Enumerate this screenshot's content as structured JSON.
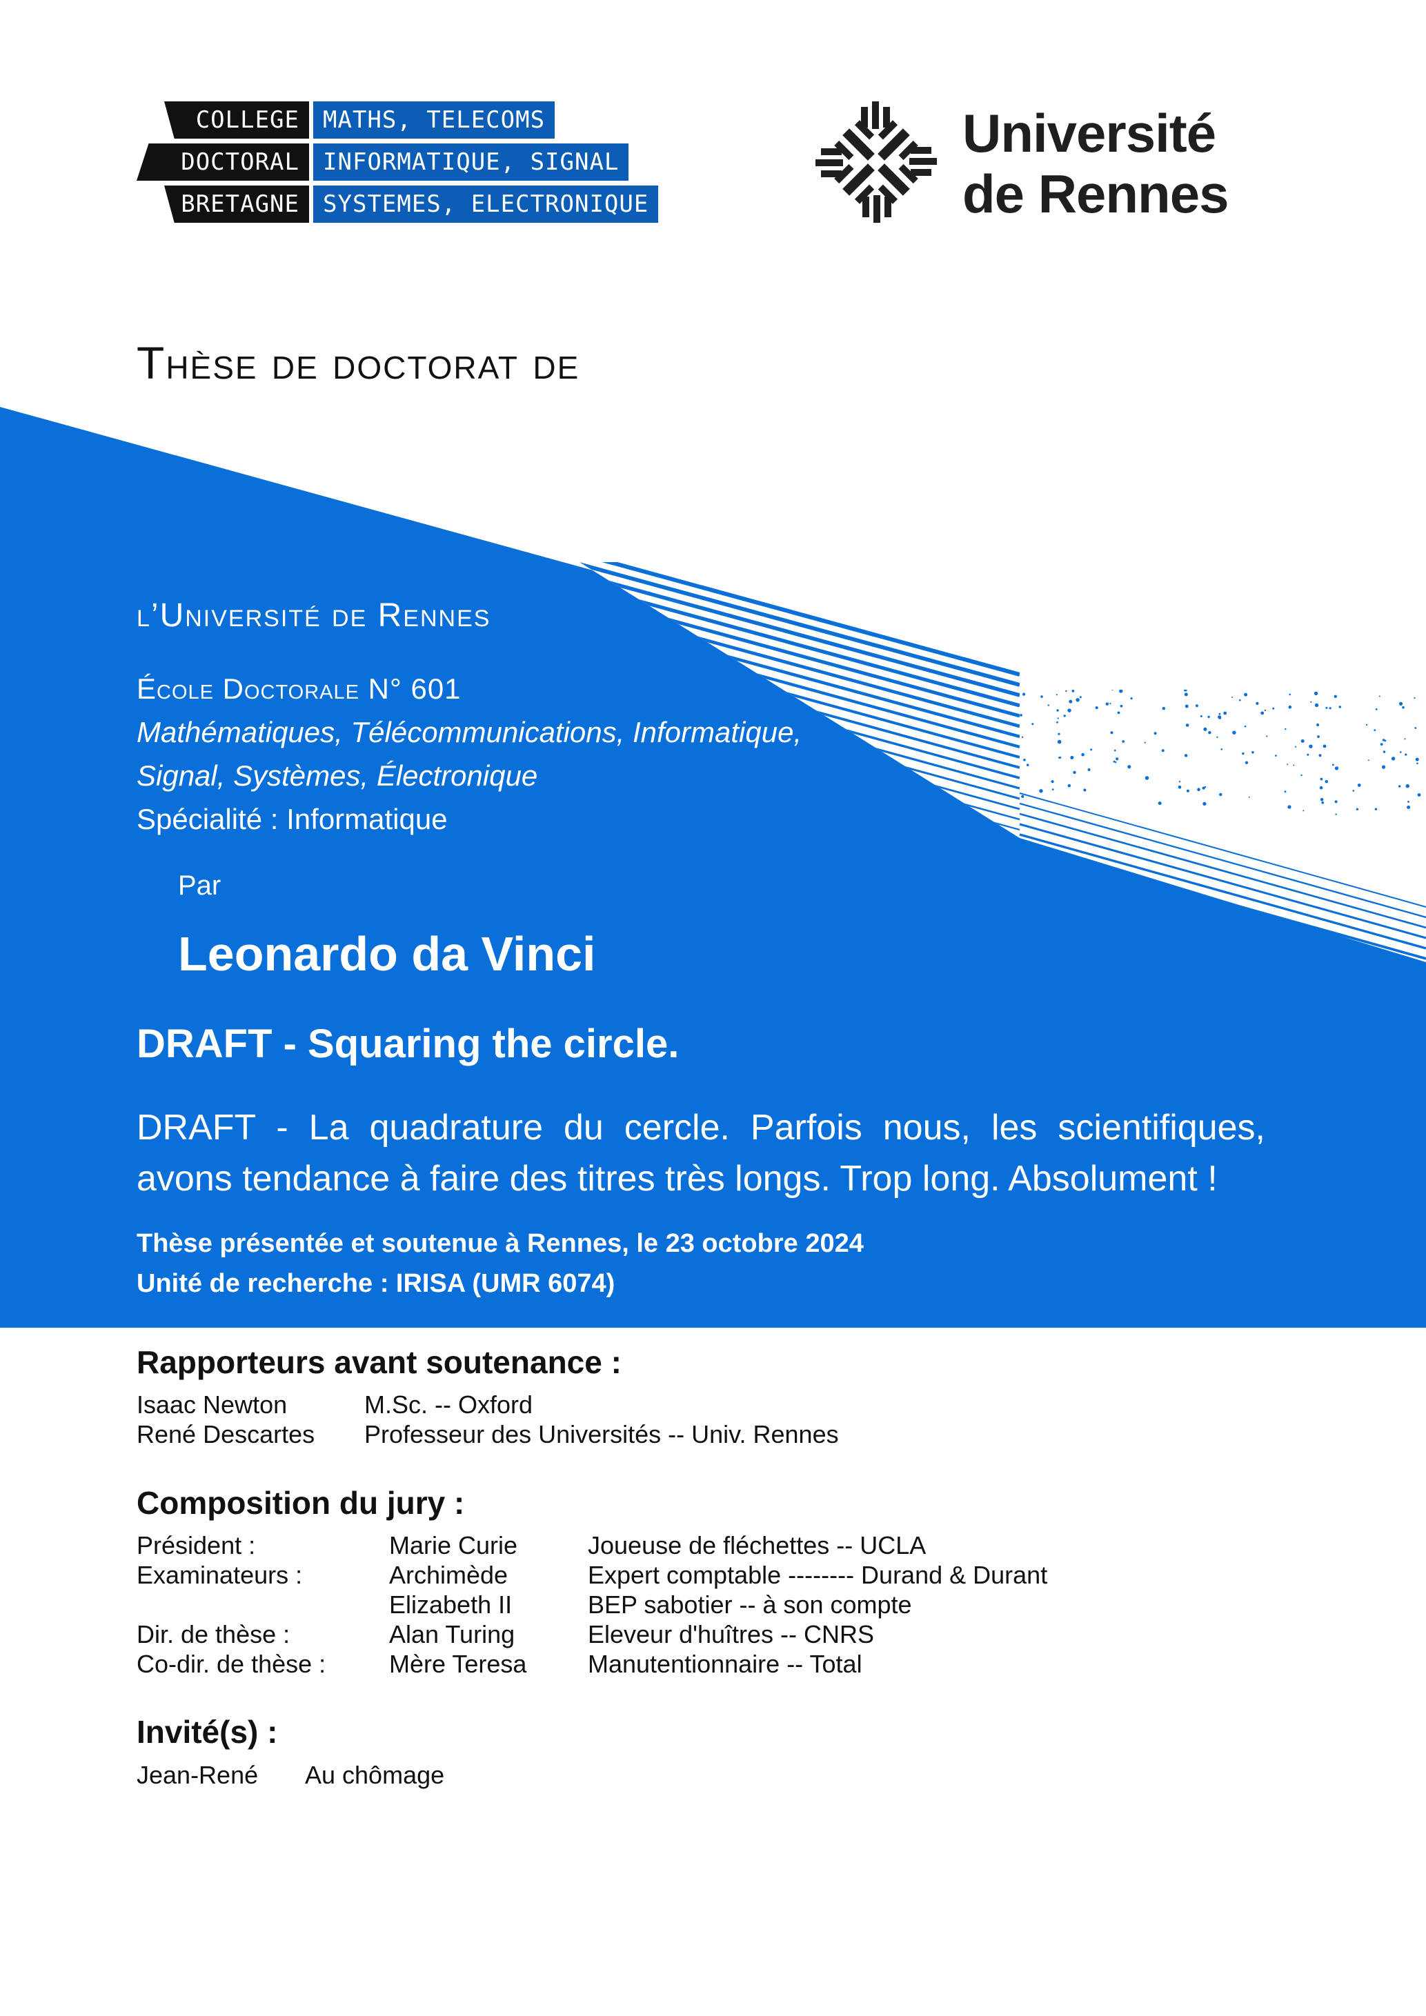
{
  "logos": {
    "college_doctoral": {
      "rows": [
        {
          "left": "COLLEGE",
          "right": "MATHS, TELECOMS"
        },
        {
          "left": "DOCTORAL",
          "right": "INFORMATIQUE, SIGNAL"
        },
        {
          "left": "BRETAGNE",
          "right": "SYSTEMES, ELECTRONIQUE"
        }
      ]
    },
    "universite": {
      "line1": "Université",
      "line2": "de Rennes",
      "icon": "universite-rennes-logo-mark"
    }
  },
  "heading": "Thèse de doctorat de",
  "institution": {
    "university": "l’Université de Rennes",
    "ecole": "École Doctorale N° 601",
    "ecole_line1": "Mathématiques, Télécommunications, Informatique,",
    "ecole_line2": "Signal, Systèmes, Électronique",
    "specialite": "Spécialité : Informatique"
  },
  "by": "Par",
  "author": "Leonardo da Vinci",
  "title_en": "DRAFT - Squaring the circle.",
  "title_fr": "DRAFT - La quadrature du cercle. Parfois nous, les scientifiques, avons tendance à faire des titres très longs. Trop long. Absolument !",
  "defense": "Thèse présentée et soutenue à Rennes, le 23 octobre 2024",
  "unit": "Unité de recherche : IRISA (UMR 6074)",
  "rapporteurs": {
    "title": "Rapporteurs avant soutenance :",
    "rows": [
      {
        "name": "Isaac Newton",
        "desc": "M.Sc. -- Oxford"
      },
      {
        "name": "René Descartes",
        "desc": "Professeur des Universités -- Univ. Rennes"
      }
    ]
  },
  "jury": {
    "title": "Composition du jury :",
    "rows": [
      {
        "role": "Président :",
        "name": "Marie Curie",
        "desc": "Joueuse de fléchettes -- UCLA"
      },
      {
        "role": "Examinateurs :",
        "name": "Archimède",
        "desc": "Expert comptable -------- Durand & Durant"
      },
      {
        "role": "",
        "name": "Elizabeth II",
        "desc": "BEP sabotier -- à son compte"
      },
      {
        "role": "Dir. de thèse :",
        "name": "Alan Turing",
        "desc": "Eleveur d'huîtres -- CNRS"
      },
      {
        "role": "Co-dir. de thèse :",
        "name": "Mère Teresa",
        "desc": "Manutentionnaire -- Total"
      }
    ]
  },
  "invites": {
    "title": "Invité(s) :",
    "rows": [
      {
        "name": "Jean-René",
        "desc": "Au chômage"
      }
    ]
  },
  "colors": {
    "band_blue": "#0a6fd9",
    "logo_blue": "#0c5db5",
    "text_dark": "#111111"
  }
}
